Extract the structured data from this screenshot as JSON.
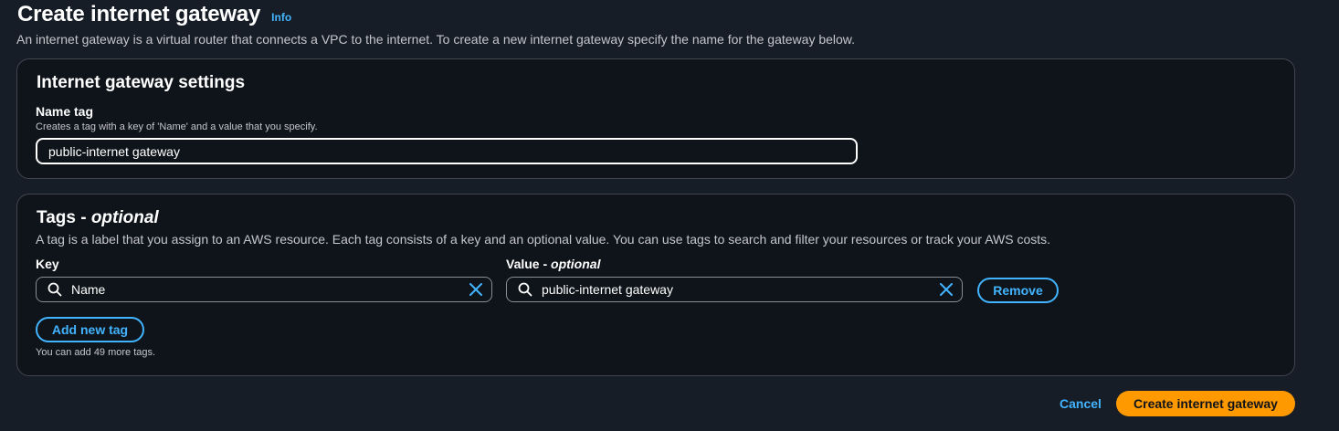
{
  "header": {
    "title": "Create internet gateway",
    "info_label": "Info",
    "description": "An internet gateway is a virtual router that connects a VPC to the internet. To create a new internet gateway specify the name for the gateway below."
  },
  "settings": {
    "title": "Internet gateway settings",
    "name_tag": {
      "label": "Name tag",
      "description": "Creates a tag with a key of 'Name' and a value that you specify.",
      "value": "public-internet gateway"
    }
  },
  "tags": {
    "title": "Tags - ",
    "title_optional": "optional",
    "description": "A tag is a label that you assign to an AWS resource. Each tag consists of a key and an optional value. You can use tags to search and filter your resources or track your AWS costs.",
    "key_label": "Key",
    "value_label": "Value - ",
    "value_label_optional": "optional",
    "rows": [
      {
        "key": "Name",
        "value": "public-internet gateway"
      }
    ],
    "remove_label": "Remove",
    "add_label": "Add new tag",
    "remaining_text": "You can add 49 more tags."
  },
  "footer": {
    "cancel_label": "Cancel",
    "submit_label": "Create internet gateway"
  },
  "icons": {
    "search": "search-icon",
    "clear": "close-icon"
  },
  "colors": {
    "background": "#161d26",
    "panel": "#0f141a",
    "link": "#42b4ff",
    "primary": "#ff9900"
  }
}
